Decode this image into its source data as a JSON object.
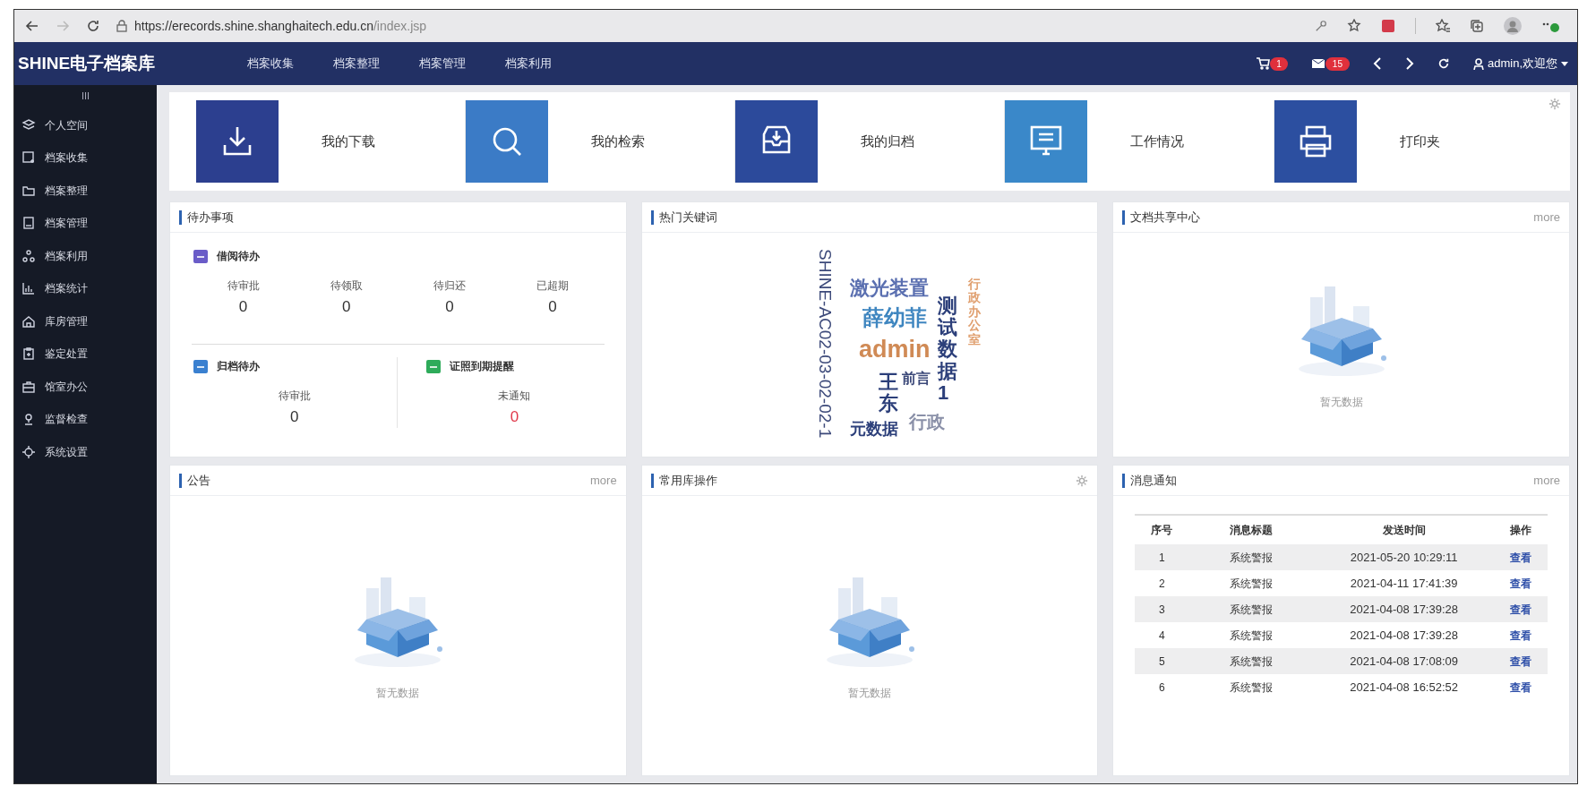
{
  "browser": {
    "url_host": "https://erecords.shine.shanghaitech.edu.cn",
    "url_path": "/index.jsp"
  },
  "navbar": {
    "brand": "SHINE电子档案库",
    "menu": [
      "档案收集",
      "档案整理",
      "档案管理",
      "档案利用"
    ],
    "cart_count": "1",
    "mail_count": "15",
    "user": "admin,欢迎您"
  },
  "sidebar": {
    "toggle": "III",
    "items": [
      "个人空间",
      "档案收集",
      "档案整理",
      "档案管理",
      "档案利用",
      "档案统计",
      "库房管理",
      "鉴定处置",
      "馆室办公",
      "监督检查",
      "系统设置"
    ]
  },
  "shortcuts": [
    {
      "label": "我的下载",
      "color": "#2c3f8f"
    },
    {
      "label": "我的检索",
      "color": "#3b7bc6"
    },
    {
      "label": "我的归档",
      "color": "#2c4a9b"
    },
    {
      "label": "工作情况",
      "color": "#3a88c9"
    },
    {
      "label": "打印夹",
      "color": "#2c4fa0"
    }
  ],
  "todo": {
    "title": "待办事项",
    "borrow": {
      "title": "借阅待办",
      "stats": [
        {
          "label": "待审批",
          "value": "0",
          "alert": false
        },
        {
          "label": "待领取",
          "value": "0",
          "alert": false
        },
        {
          "label": "待归还",
          "value": "0",
          "alert": false
        },
        {
          "label": "已超期",
          "value": "0",
          "alert": false
        }
      ]
    },
    "archive": {
      "title": "归档待办",
      "stats": [
        {
          "label": "待审批",
          "value": "0",
          "alert": false
        }
      ]
    },
    "license": {
      "title": "证照到期提醒",
      "stats": [
        {
          "label": "未通知",
          "value": "0",
          "alert": true
        }
      ]
    }
  },
  "keywords": {
    "title": "热门关键词",
    "words": [
      {
        "text": "SHINE-AC02-03-02-02-1",
        "kind": "rotated",
        "color": "#3d4a7a"
      },
      {
        "text": "激光装置",
        "kind": "horizontal",
        "color": "#5a6fb0"
      },
      {
        "text": "薛幼菲",
        "kind": "horizontal",
        "color": "#3f86c0"
      },
      {
        "text": "admin",
        "kind": "horizontal",
        "color": "#d08a55"
      },
      {
        "text": "测试数据1",
        "kind": "vertical",
        "color": "#2c3f7a"
      },
      {
        "text": "行政办公室",
        "kind": "vertical",
        "color": "#e0a070"
      },
      {
        "text": "王东",
        "kind": "vertical",
        "color": "#2c3f7a"
      },
      {
        "text": "前言",
        "kind": "horizontal",
        "color": "#3d4a7a"
      },
      {
        "text": "元数据",
        "kind": "horizontal",
        "color": "#2c3f7a"
      },
      {
        "text": "行政",
        "kind": "horizontal",
        "color": "#8a90a8"
      }
    ]
  },
  "share": {
    "title": "文档共享中心",
    "more": "more",
    "empty": "暂无数据"
  },
  "notice": {
    "title": "公告",
    "more": "more",
    "empty": "暂无数据"
  },
  "common": {
    "title": "常用库操作",
    "empty": "暂无数据"
  },
  "messages": {
    "title": "消息通知",
    "more": "more",
    "columns": [
      "序号",
      "消息标题",
      "发送时间",
      "操作"
    ],
    "rows": [
      [
        "1",
        "系统警报",
        "2021-05-20 10:29:11",
        "查看"
      ],
      [
        "2",
        "系统警报",
        "2021-04-11 17:41:39",
        "查看"
      ],
      [
        "3",
        "系统警报",
        "2021-04-08 17:39:28",
        "查看"
      ],
      [
        "4",
        "系统警报",
        "2021-04-08 17:39:28",
        "查看"
      ],
      [
        "5",
        "系统警报",
        "2021-04-08 17:08:09",
        "查看"
      ],
      [
        "6",
        "系统警报",
        "2021-04-08 16:52:52",
        "查看"
      ]
    ]
  }
}
